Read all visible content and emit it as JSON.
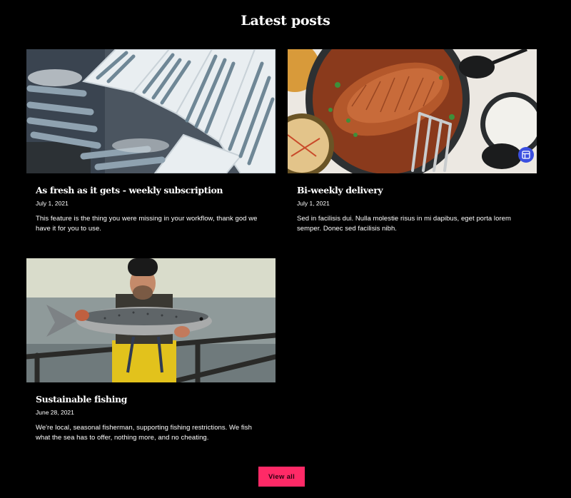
{
  "section": {
    "title": "Latest posts"
  },
  "posts": [
    {
      "title": "As fresh as it gets - weekly subscription",
      "date": "July 1, 2021",
      "excerpt": "This feature is the thing you were missing in your workflow, thank god we have it for you to use.",
      "image_icon": "fish-crates-photo"
    },
    {
      "title": "Bi-weekly delivery",
      "date": "July 1, 2021",
      "excerpt": "Sed in facilisis dui. Nulla molestie risus in mi dapibus, eget porta lorem semper. Donec sed facilisis nibh.",
      "image_icon": "fish-dish-photo"
    },
    {
      "title": "Sustainable fishing",
      "date": "June 28, 2021",
      "excerpt": "We're local, seasonal fisherman, supporting fishing restrictions. We fish what the sea has to offer, nothing more, and no cheating.",
      "image_icon": "fisherman-photo"
    }
  ],
  "actions": {
    "view_all_label": "View all"
  },
  "colors": {
    "background": "#000000",
    "text": "#ffffff",
    "accent_button": "#ff2a67",
    "edit_badge": "#3b4fe0"
  }
}
